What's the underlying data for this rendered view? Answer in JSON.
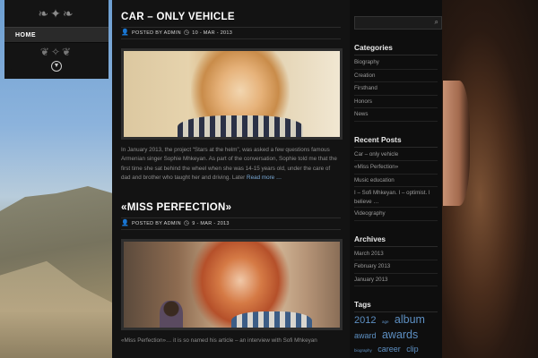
{
  "nav": {
    "home_label": "HOME"
  },
  "posts": [
    {
      "title": "CAR – ONLY VEHICLE",
      "author_text": "POSTED BY ADMIN",
      "date_text": "10 - MAR - 2013",
      "excerpt": "In January 2013, the project “Stars at the helm”, was asked a few questions famous Armenian singer Sophie Mhkeyan. As part of the conversation, Sophie told me that the first time she sat behind the wheel when she was 14-15 years old, under the care of dad and brother who taught her and driving. Later",
      "read_more": "Read more …"
    },
    {
      "title": "«MISS PERFECTION»",
      "author_text": "POSTED BY ADMIN",
      "date_text": "9 - MAR - 2013",
      "excerpt": "«Miss Perfection»… it is so named his article – an interview with Sofi Mhkeyan"
    }
  ],
  "sidebar": {
    "categories": {
      "title": "Categories",
      "items": [
        "Biography",
        "Creation",
        "Firsthand",
        "Honors",
        "News"
      ]
    },
    "recent_posts": {
      "title": "Recent Posts",
      "items": [
        "Car – only vehicle",
        "«Miss Perfection»",
        "Music education",
        "I – Sofi Mhkeyan. I – optimist. I believe …",
        "Videography"
      ]
    },
    "archives": {
      "title": "Archives",
      "items": [
        "March 2013",
        "February 2013",
        "January 2013"
      ]
    },
    "tags": {
      "title": "Tags",
      "items": [
        "2012",
        "age",
        "album",
        "award",
        "awards",
        "biography",
        "career",
        "clip"
      ]
    }
  }
}
